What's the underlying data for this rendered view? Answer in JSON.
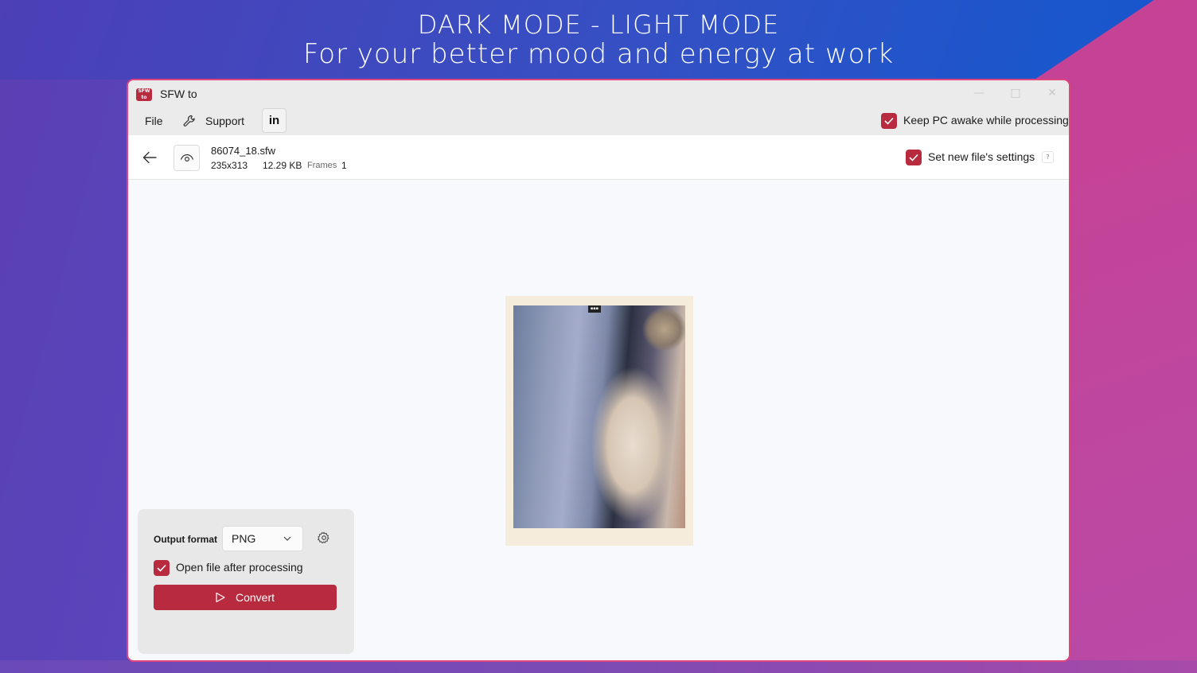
{
  "promo": {
    "line1": "DARK MODE - LIGHT MODE",
    "line2": "For your better mood and energy at work"
  },
  "window": {
    "logo_text": "SFW to",
    "title": "SFW to",
    "controls": {
      "minimize": "—",
      "maximize": "□",
      "close": "✕"
    }
  },
  "menu": {
    "file": "File",
    "support": "Support",
    "linkedin": "in",
    "keep_awake": {
      "label": "Keep PC awake while processing",
      "checked": true
    }
  },
  "file_info": {
    "name": "86074_18.sfw",
    "dimensions": "235x313",
    "size": "12.29 KB",
    "frames_label": "Frames",
    "frames_value": "1",
    "new_settings": {
      "label": "Set new file's settings",
      "checked": true
    },
    "help": "?"
  },
  "preview": {
    "stamp_text": "▪▪▪"
  },
  "panel": {
    "output_format_label": "Output format",
    "output_format_value": "PNG",
    "open_after": {
      "label": "Open file after processing",
      "checked": true
    },
    "convert_label": "Convert"
  },
  "colors": {
    "accent": "#b82a3e",
    "window_border": "#e0457d"
  },
  "icons": [
    "back-arrow-icon",
    "eye-icon",
    "wrench-icon",
    "linkedin-icon",
    "gear-icon",
    "chevron-down-icon",
    "play-icon",
    "checkmark-icon"
  ]
}
